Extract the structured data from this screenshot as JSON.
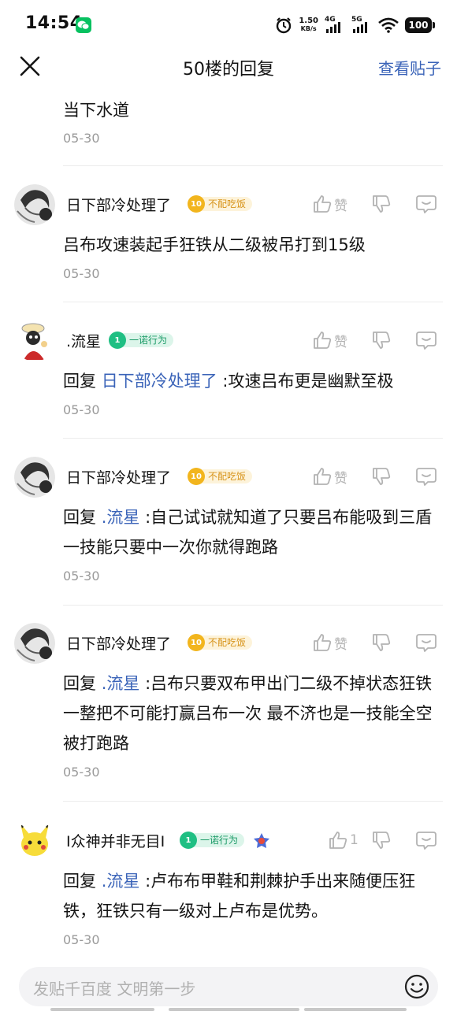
{
  "status_bar": {
    "time": "14:54",
    "speed_value": "1.50",
    "speed_unit": "KB/s",
    "net1": "4G",
    "net2": "5G",
    "battery": "100"
  },
  "nav": {
    "title": "50楼的回复",
    "view_post": "查看贴子"
  },
  "first_reply": {
    "text": "当下水道",
    "date": "05-30"
  },
  "comments": [
    {
      "username": "日下部冷处理了",
      "badge_level": "10",
      "badge_text": "不配吃饭",
      "like_label": "赞",
      "reply_prefix": "",
      "reply_to": "",
      "text": "吕布攻速装起手狂铁从二级被吊打到15级",
      "date": "05-30"
    },
    {
      "username": ".流星",
      "badge_level": "1",
      "badge_text": "一诺行为",
      "like_label": "赞",
      "reply_prefix": "回复",
      "reply_to": "日下部冷处理了",
      "text": ":攻速吕布更是幽默至极",
      "date": "05-30"
    },
    {
      "username": "日下部冷处理了",
      "badge_level": "10",
      "badge_text": "不配吃饭",
      "like_label": "赞",
      "reply_prefix": "回复",
      "reply_to": ".流星",
      "text": ":自己试试就知道了只要吕布能吸到三盾一技能只要中一次你就得跑路",
      "date": "05-30"
    },
    {
      "username": "日下部冷处理了",
      "badge_level": "10",
      "badge_text": "不配吃饭",
      "like_label": "赞",
      "reply_prefix": "回复",
      "reply_to": ".流星",
      "text": ":吕布只要双布甲出门二级不掉状态狂铁一整把不可能打赢吕布一次 最不济也是一技能全空被打跑路",
      "date": "05-30"
    },
    {
      "username": "I众神并非无目I",
      "badge_level": "1",
      "badge_text": "一诺行为",
      "like_label": "1",
      "reply_prefix": "回复",
      "reply_to": ".流星",
      "text": ":卢布布甲鞋和荆棘护手出来随便压狂铁，狂铁只有一级对上卢布是优势。",
      "date": "05-30"
    }
  ],
  "bottom": {
    "placeholder": "发贴千百度 文明第一步"
  },
  "colors": {
    "link": "#3a63b8",
    "badge_gold": "#f2b51d",
    "badge_green": "#1fbf83"
  },
  "icons": [
    "close-icon",
    "thumbs-up-icon",
    "thumbs-down-icon",
    "comment-icon",
    "emoji-icon",
    "wechat-icon",
    "alarm-icon",
    "wifi-icon"
  ]
}
